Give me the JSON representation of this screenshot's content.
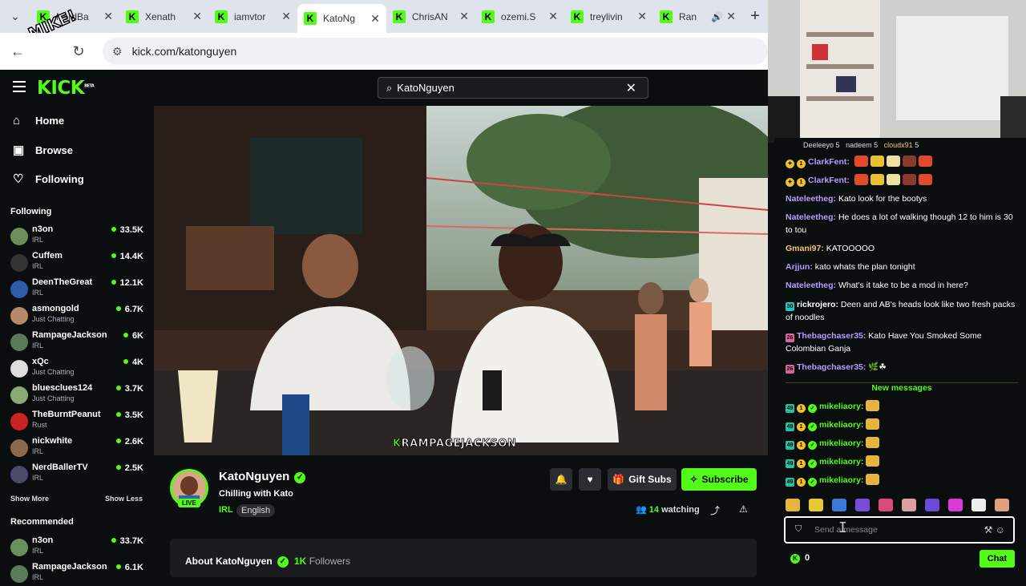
{
  "browser": {
    "tabs": [
      {
        "label": "NerdBa",
        "active": false
      },
      {
        "label": "Xenath",
        "active": false
      },
      {
        "label": "iamvtor",
        "active": false
      },
      {
        "label": "KatoNg",
        "active": true
      },
      {
        "label": "ChrisAN",
        "active": false
      },
      {
        "label": "ozemi.S",
        "active": false
      },
      {
        "label": "treylivin",
        "active": false
      },
      {
        "label": "Ran",
        "active": false,
        "audio": true
      }
    ],
    "url": "kick.com/katonguyen",
    "overlay_text": "MIKE!"
  },
  "header": {
    "logo": "KICK",
    "logo_badge": "BETA",
    "search_value": "KatoNguyen"
  },
  "nav": {
    "main": [
      {
        "label": "Home",
        "icon": "home-icon"
      },
      {
        "label": "Browse",
        "icon": "browse-icon"
      },
      {
        "label": "Following",
        "icon": "heart-icon"
      }
    ],
    "following_title": "Following",
    "following": [
      {
        "name": "n3on",
        "category": "IRL",
        "viewers": "33.5K",
        "color": "#6a8f5a"
      },
      {
        "name": "Cuffem",
        "category": "IRL",
        "viewers": "14.4K",
        "color": "#333"
      },
      {
        "name": "DeenTheGreat",
        "category": "IRL",
        "viewers": "12.1K",
        "color": "#2d5da8"
      },
      {
        "name": "asmongold",
        "category": "Just Chatting",
        "viewers": "6.7K",
        "color": "#b58a6a"
      },
      {
        "name": "RampageJackson",
        "category": "IRL",
        "viewers": "6K",
        "color": "#5a7a5a"
      },
      {
        "name": "xQc",
        "category": "Just Chatting",
        "viewers": "4K",
        "color": "#ddd"
      },
      {
        "name": "bluesclues124",
        "category": "Just Chatting",
        "viewers": "3.7K",
        "color": "#88aa77"
      },
      {
        "name": "TheBurntPeanut",
        "category": "Rust",
        "viewers": "3.5K",
        "color": "#cc2222"
      },
      {
        "name": "nickwhite",
        "category": "IRL",
        "viewers": "2.6K",
        "color": "#8a6a4a"
      },
      {
        "name": "NerdBallerTV",
        "category": "IRL",
        "viewers": "2.5K",
        "color": "#4a4a6a"
      }
    ],
    "show_more": "Show More",
    "show_less": "Show Less",
    "recommended_title": "Recommended",
    "recommended": [
      {
        "name": "n3on",
        "category": "IRL",
        "viewers": "33.7K",
        "color": "#6a8f5a"
      },
      {
        "name": "RampageJackson",
        "category": "IRL",
        "viewers": "6.1K",
        "color": "#5a7a5a"
      }
    ]
  },
  "video": {
    "caption_k": "K",
    "caption_rest": "RAMPAGEJACKSON"
  },
  "channel": {
    "name": "KatoNguyen",
    "live": "LIVE",
    "title": "Chilling with Kato",
    "category": "IRL",
    "language": "English",
    "gift_label": "Gift Subs",
    "subscribe_label": "Subscribe",
    "viewers": "14",
    "viewers_suffix": "watching",
    "about_title": "About KatoNguyen",
    "followers_count": "1K",
    "followers_label": "Followers"
  },
  "chat": {
    "top_gifters": [
      {
        "name": "Deeleeyo",
        "count": "5"
      },
      {
        "name": "nadeem",
        "count": "5"
      },
      {
        "name": "cloudx91",
        "count": "5"
      }
    ],
    "messages": [
      {
        "user": "ClarkFent:",
        "text": "",
        "color": "#b59cff",
        "emotes": 5
      },
      {
        "user": "ClarkFent:",
        "text": "",
        "color": "#b59cff",
        "emotes": 5
      },
      {
        "user": "Nateleetheg:",
        "text": "Kato look for the bootys",
        "color": "#b59cff"
      },
      {
        "user": "Nateleetheg:",
        "text": "He does a lot of walking though 12 to him is 30 to tou",
        "color": "#b59cff"
      },
      {
        "user": "Gmani97:",
        "text": "KATOOOOO",
        "color": "#f5c56e"
      },
      {
        "user": "Arjjun:",
        "text": "kato whats the plan tonight",
        "color": "#b59cff"
      },
      {
        "user": "Nateleetheg:",
        "text": "What's it take to be a mod in here?",
        "color": "#b59cff"
      },
      {
        "user": "rickrojero:",
        "text": "Deen and AB's heads look like two fresh packs of noodles",
        "color": "#fff"
      },
      {
        "user": "Thebagchaser35:",
        "text": "Kato Have You Smoked Some Colombian Ganja",
        "color": "#b59cff"
      },
      {
        "user": "Thebagchaser35:",
        "text": "🌿☘",
        "color": "#b59cff"
      }
    ],
    "new_messages_label": "New messages",
    "new_messages": [
      {
        "user": "mikeliaory:",
        "color": "#53fc18"
      },
      {
        "user": "mikeliaory:",
        "color": "#53fc18"
      },
      {
        "user": "mikeliaory:",
        "color": "#53fc18"
      },
      {
        "user": "mikeliaory:",
        "color": "#53fc18"
      },
      {
        "user": "mikeliaory:",
        "color": "#53fc18"
      }
    ],
    "input_placeholder": "Send a message",
    "kicks_count": "0",
    "send_label": "Chat"
  }
}
